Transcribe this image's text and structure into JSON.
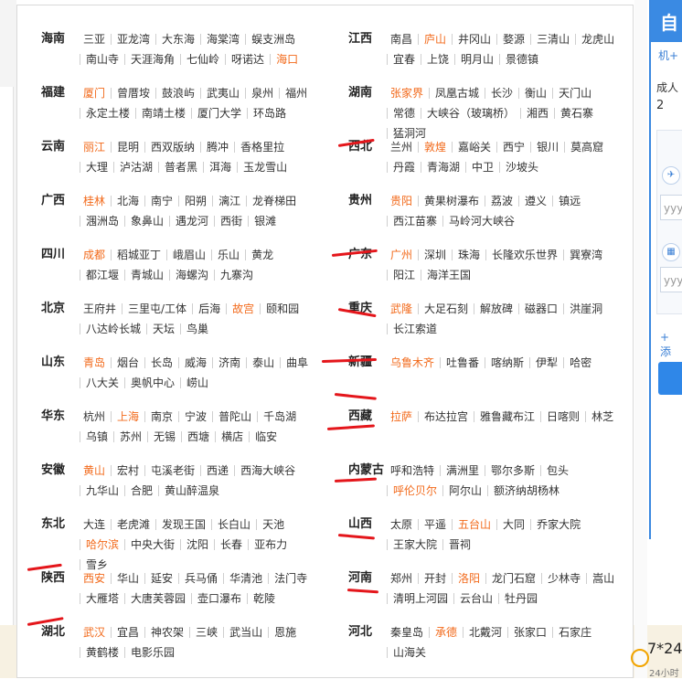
{
  "regions_left": [
    {
      "province": "海南",
      "sites": [
        "三亚",
        "亚龙湾",
        "大东海",
        "海棠湾",
        "蜈支洲岛",
        "南山寺",
        "天涯海角",
        "七仙岭",
        "呀诺达",
        "海口"
      ],
      "hot": [
        "海口"
      ]
    },
    {
      "province": "福建",
      "sites": [
        "厦门",
        "曾厝垵",
        "鼓浪屿",
        "武夷山",
        "泉州",
        "福州",
        "永定土楼",
        "南靖土楼",
        "厦门大学",
        "环岛路"
      ],
      "hot": [
        "厦门"
      ]
    },
    {
      "province": "云南",
      "sites": [
        "丽江",
        "昆明",
        "西双版纳",
        "腾冲",
        "香格里拉",
        "大理",
        "泸沽湖",
        "普者黑",
        "洱海",
        "玉龙雪山"
      ],
      "hot": [
        "丽江"
      ]
    },
    {
      "province": "广西",
      "sites": [
        "桂林",
        "北海",
        "南宁",
        "阳朔",
        "漓江",
        "龙脊梯田",
        "涠洲岛",
        "象鼻山",
        "遇龙河",
        "西街",
        "银滩"
      ],
      "hot": [
        "桂林"
      ]
    },
    {
      "province": "四川",
      "sites": [
        "成都",
        "稻城亚丁",
        "峨眉山",
        "乐山",
        "黄龙",
        "都江堰",
        "青城山",
        "海螺沟",
        "九寨沟"
      ],
      "hot": [
        "成都"
      ]
    },
    {
      "province": "北京",
      "sites": [
        "王府井",
        "三里屯/工体",
        "后海",
        "故宫",
        "颐和园",
        "八达岭长城",
        "天坛",
        "鸟巢"
      ],
      "hot": [
        "故宫"
      ]
    },
    {
      "province": "山东",
      "sites": [
        "青岛",
        "烟台",
        "长岛",
        "威海",
        "济南",
        "泰山",
        "曲阜",
        "八大关",
        "奥帆中心",
        "崂山"
      ],
      "hot": [
        "青岛"
      ]
    },
    {
      "province": "华东",
      "sites": [
        "杭州",
        "上海",
        "南京",
        "宁波",
        "普陀山",
        "千岛湖",
        "乌镇",
        "苏州",
        "无锡",
        "西塘",
        "横店",
        "临安"
      ],
      "hot": [
        "上海"
      ]
    },
    {
      "province": "安徽",
      "sites": [
        "黄山",
        "宏村",
        "屯溪老街",
        "西递",
        "西海大峡谷",
        "九华山",
        "合肥",
        "黄山醉温泉"
      ],
      "hot": [
        "黄山"
      ]
    },
    {
      "province": "东北",
      "sites": [
        "大连",
        "老虎滩",
        "发现王国",
        "长白山",
        "天池",
        "哈尔滨",
        "中央大街",
        "沈阳",
        "长春",
        "亚布力",
        "雪乡"
      ],
      "hot": [
        "哈尔滨"
      ]
    },
    {
      "province": "陕西",
      "sites": [
        "西安",
        "华山",
        "延安",
        "兵马俑",
        "华清池",
        "法门寺",
        "大雁塔",
        "大唐芙蓉园",
        "壶口瀑布",
        "乾陵"
      ],
      "hot": [
        "西安"
      ]
    },
    {
      "province": "湖北",
      "sites": [
        "武汉",
        "宜昌",
        "神农架",
        "三峡",
        "武当山",
        "恩施",
        "黄鹤楼",
        "电影乐园"
      ],
      "hot": [
        "武汉"
      ]
    }
  ],
  "regions_right": [
    {
      "province": "江西",
      "sites": [
        "南昌",
        "庐山",
        "井冈山",
        "婺源",
        "三清山",
        "龙虎山",
        "宜春",
        "上饶",
        "明月山",
        "景德镇"
      ],
      "hot": [
        "庐山"
      ]
    },
    {
      "province": "湖南",
      "sites": [
        "张家界",
        "凤凰古城",
        "长沙",
        "衡山",
        "天门山",
        "常德",
        "大峡谷（玻璃桥）",
        "湘西",
        "黄石寨",
        "猛洞河"
      ],
      "hot": [
        "张家界"
      ]
    },
    {
      "province": "西北",
      "sites": [
        "兰州",
        "敦煌",
        "嘉峪关",
        "西宁",
        "银川",
        "莫高窟",
        "丹霞",
        "青海湖",
        "中卫",
        "沙坡头"
      ],
      "hot": [
        "敦煌"
      ]
    },
    {
      "province": "贵州",
      "sites": [
        "贵阳",
        "黄果树瀑布",
        "荔波",
        "遵义",
        "镇远",
        "西江苗寨",
        "马岭河大峡谷"
      ],
      "hot": [
        "贵阳"
      ]
    },
    {
      "province": "广东",
      "sites": [
        "广州",
        "深圳",
        "珠海",
        "长隆欢乐世界",
        "巽寮湾",
        "阳江",
        "海洋王国"
      ],
      "hot": [
        "广州"
      ]
    },
    {
      "province": "重庆",
      "sites": [
        "武隆",
        "大足石刻",
        "解放碑",
        "磁器口",
        "洪崖洞",
        "长江索道"
      ],
      "hot": [
        "武隆"
      ]
    },
    {
      "province": "新疆",
      "sites": [
        "乌鲁木齐",
        "吐鲁番",
        "喀纳斯",
        "伊犁",
        "哈密"
      ],
      "hot": [
        "乌鲁木齐"
      ]
    },
    {
      "province": "西藏",
      "sites": [
        "拉萨",
        "布达拉宫",
        "雅鲁藏布江",
        "日喀则",
        "林芝"
      ],
      "hot": [
        "拉萨"
      ]
    },
    {
      "province": "内蒙古",
      "sites": [
        "呼和浩特",
        "满洲里",
        "鄂尔多斯",
        "包头",
        "呼伦贝尔",
        "阿尔山",
        "额济纳胡杨林"
      ],
      "hot": [
        "呼伦贝尔"
      ]
    },
    {
      "province": "山西",
      "sites": [
        "太原",
        "平遥",
        "五台山",
        "大同",
        "乔家大院",
        "王家大院",
        "晋祠"
      ],
      "hot": [
        "五台山"
      ]
    },
    {
      "province": "河南",
      "sites": [
        "郑州",
        "开封",
        "洛阳",
        "龙门石窟",
        "少林寺",
        "嵩山",
        "清明上河园",
        "云台山",
        "牡丹园"
      ],
      "hot": [
        "洛阳"
      ]
    },
    {
      "province": "河北",
      "sites": [
        "秦皇岛",
        "承德",
        "北戴河",
        "张家口",
        "石家庄",
        "山海关"
      ],
      "hot": [
        "承德"
      ]
    }
  ],
  "side_panel": {
    "title": "自",
    "subtitle": "机+",
    "adult_label": "成人",
    "adult_count": "2",
    "input_placeholder_1": "yyy",
    "input_placeholder_2": "yyy",
    "add_label": "+ 添",
    "hotline": "7*24",
    "hotline_sub": "24小时"
  },
  "colors": {
    "hot": "#f26a1b",
    "annotation": "#e4161b",
    "accent": "#3a88e0"
  }
}
